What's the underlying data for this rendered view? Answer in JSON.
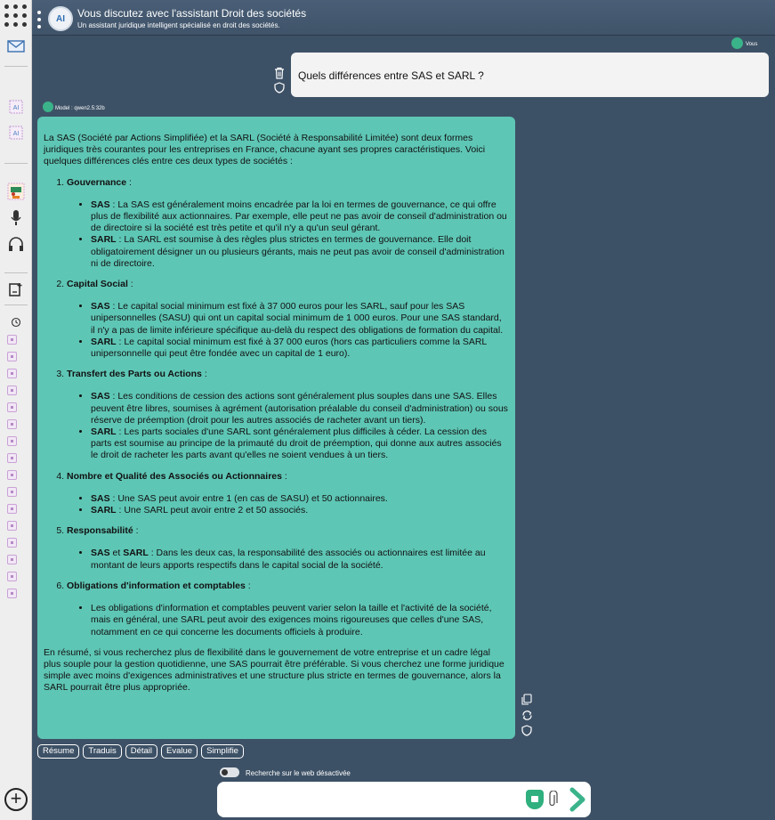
{
  "header": {
    "title": "Vous discutez avec l'assistant Droit des sociétés",
    "subtitle": "Un assistant juridique intelligent spécialisé en droit des sociétés.",
    "logo_text": "AI"
  },
  "user": {
    "label": "Vous",
    "message": "Quels différences entre SAS et SARL ?"
  },
  "assistant": {
    "model_label": "Model : qwen2.5:32b",
    "intro": "La SAS (Société par Actions Simplifiée) et la SARL (Société à Responsabilité Limitée) sont deux formes juridiques très courantes pour les entreprises en France, chacune ayant ses propres caractéristiques. Voici quelques différences clés entre ces deux types de sociétés :",
    "sections": [
      {
        "title": "Gouvernance",
        "items": [
          {
            "lead": "SAS",
            "text": " : La SAS est généralement moins encadrée par la loi en termes de gouvernance, ce qui offre plus de flexibilité aux actionnaires. Par exemple, elle peut ne pas avoir de conseil d'administration ou de directoire si la société est très petite et qu'il n'y a qu'un seul gérant."
          },
          {
            "lead": "SARL",
            "text": " : La SARL est soumise à des règles plus strictes en termes de gouvernance. Elle doit obligatoirement désigner un ou plusieurs gérants, mais ne peut pas avoir de conseil d'administration ni de directoire."
          }
        ]
      },
      {
        "title": "Capital Social",
        "items": [
          {
            "lead": "SAS",
            "text": " : Le capital social minimum est fixé à 37 000 euros pour les SARL, sauf pour les SAS unipersonnelles (SASU) qui ont un capital social minimum de 1 000 euros. Pour une SAS standard, il n'y a pas de limite inférieure spécifique au-delà du respect des obligations de formation du capital."
          },
          {
            "lead": "SARL",
            "text": " : Le capital social minimum est fixé à 37 000 euros (hors cas particuliers comme la SARL unipersonnelle qui peut être fondée avec un capital de 1 euro)."
          }
        ]
      },
      {
        "title": "Transfert des Parts ou Actions",
        "items": [
          {
            "lead": "SAS",
            "text": " : Les conditions de cession des actions sont généralement plus souples dans une SAS. Elles peuvent être libres, soumises à agrément (autorisation préalable du conseil d'administration) ou sous réserve de préemption (droit pour les autres associés de racheter avant un tiers)."
          },
          {
            "lead": "SARL",
            "text": " : Les parts sociales d'une SARL sont généralement plus difficiles à céder. La cession des parts est soumise au principe de la primauté du droit de préemption, qui donne aux autres associés le droit de racheter les parts avant qu'elles ne soient vendues à un tiers."
          }
        ]
      },
      {
        "title": "Nombre et Qualité des Associés ou Actionnaires",
        "items": [
          {
            "lead": "SAS",
            "text": " : Une SAS peut avoir entre 1 (en cas de SASU) et 50 actionnaires."
          },
          {
            "lead": "SARL",
            "text": " : Une SARL peut avoir entre 2 et 50 associés."
          }
        ]
      },
      {
        "title": "Responsabilité",
        "items": [
          {
            "lead": "SAS",
            "mid": " et ",
            "lead2": "SARL",
            "text": " : Dans les deux cas, la responsabilité des associés ou actionnaires est limitée au montant de leurs apports respectifs dans le capital social de la société."
          }
        ]
      },
      {
        "title": "Obligations d'information et comptables",
        "items": [
          {
            "lead": "",
            "text": "Les obligations d'information et comptables peuvent varier selon la taille et l'activité de la société, mais en général, une SARL peut avoir des exigences moins rigoureuses que celles d'une SAS, notamment en ce qui concerne les documents officiels à produire."
          }
        ]
      }
    ],
    "conclusion": "En résumé, si vous recherchez plus de flexibilité dans le gouvernement de votre entreprise et un cadre légal plus souple pour la gestion quotidienne, une SAS pourrait être préférable. Si vous cherchez une forme juridique simple avec moins d'exigences administratives et une structure plus stricte en termes de gouvernance, alors la SARL pourrait être plus appropriée."
  },
  "actions": [
    "Résume",
    "Traduis",
    "Détail",
    "Evalue",
    "Simplifie"
  ],
  "web_search": {
    "label": "Recherche sur le web désactivée",
    "enabled": false
  },
  "input": {
    "placeholder": "",
    "value": ""
  },
  "sidebar": {
    "icons": [
      "grid-icon",
      "mail-icon",
      "ai-chip-icon",
      "ai-chip-icon",
      "teacher-icon",
      "microphone-icon",
      "headset-icon",
      "new-note-icon",
      "history-icon"
    ],
    "history_count": 16
  },
  "colors": {
    "accent": "#5ec6b5",
    "background": "#3d5166",
    "badge": "#3bb38a"
  }
}
